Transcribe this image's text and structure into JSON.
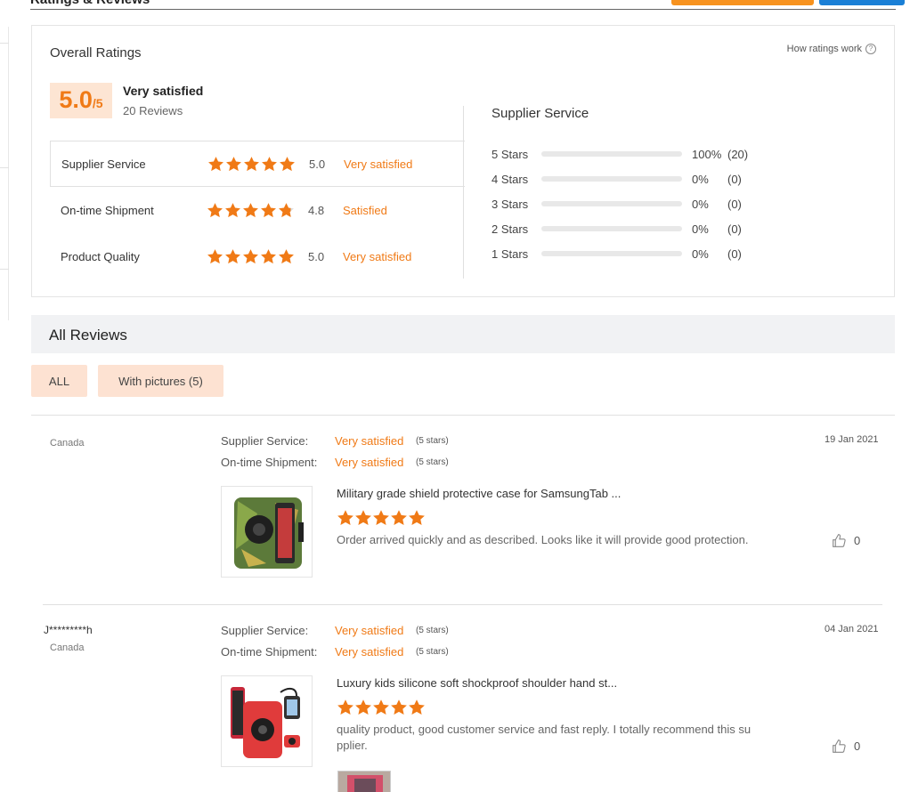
{
  "section_header": {
    "title": "Ratings & Reviews",
    "colors": {
      "primary_button": "#f7921e",
      "secondary_button": "#1a7fd6"
    }
  },
  "overall": {
    "title": "Overall Ratings",
    "how_link": "How ratings work",
    "help_icon": "question-circle-icon",
    "score": "5.0",
    "score_max": "/5",
    "label": "Very satisfied",
    "review_count": "20 Reviews",
    "metrics": [
      {
        "name": "Supplier Service",
        "rating": 5.0,
        "score": "5.0",
        "text": "Very satisfied"
      },
      {
        "name": "On-time Shipment",
        "rating": 4.8,
        "score": "4.8",
        "text": "Satisfied"
      },
      {
        "name": "Product Quality",
        "rating": 5.0,
        "score": "5.0",
        "text": "Very satisfied"
      }
    ]
  },
  "distribution": {
    "title": "Supplier Service",
    "rows": [
      {
        "label": "5  Stars",
        "fraction": 1.0,
        "pct": "100%",
        "count": "(20)"
      },
      {
        "label": "4  Stars",
        "fraction": 0.0,
        "pct": "0%",
        "count": "(0)"
      },
      {
        "label": "3  Stars",
        "fraction": 0.0,
        "pct": "0%",
        "count": "(0)"
      },
      {
        "label": "2  Stars",
        "fraction": 0.0,
        "pct": "0%",
        "count": "(0)"
      },
      {
        "label": "1  Stars",
        "fraction": 0.0,
        "pct": "0%",
        "count": "(0)"
      }
    ]
  },
  "all_reviews": {
    "title": "All Reviews",
    "filters": [
      {
        "label": "ALL"
      },
      {
        "label": "With pictures (5)"
      }
    ]
  },
  "reviews": [
    {
      "user": "",
      "country": "Canada",
      "supplier_label": "Supplier Service:",
      "supplier_value": "Very satisfied",
      "supplier_stars": "(5 stars)",
      "shipment_label": "On-time Shipment:",
      "shipment_value": "Very satisfied",
      "shipment_stars": "(5 stars)",
      "date": "19 Jan 2021",
      "product": "Military grade shield protective case for SamsungTab ...",
      "rating": 5,
      "text": "Order arrived quickly and as described. Looks like it will provide good protection.",
      "likes": "0"
    },
    {
      "user": "J*********h",
      "country": "Canada",
      "supplier_label": "Supplier Service:",
      "supplier_value": "Very satisfied",
      "supplier_stars": "(5 stars)",
      "shipment_label": "On-time Shipment:",
      "shipment_value": "Very satisfied",
      "shipment_stars": "(5 stars)",
      "date": "04 Jan 2021",
      "product": "Luxury kids silicone soft shockproof shoulder hand st...",
      "rating": 5,
      "text": "quality product, good customer service and fast reply. I totally recommend this su pplier.",
      "likes": "0"
    }
  ],
  "colors": {
    "accent": "#f07a16",
    "badge_bg": "#fde5d3"
  }
}
